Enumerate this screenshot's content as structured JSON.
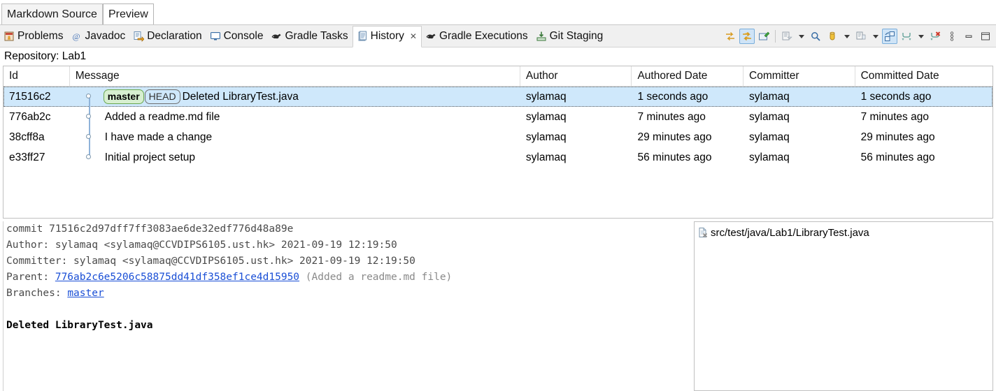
{
  "editor_tabs": [
    {
      "label": "Markdown Source",
      "active": false
    },
    {
      "label": "Preview",
      "active": true
    }
  ],
  "view_tabs": [
    {
      "label": "Problems",
      "icon": "problems-icon",
      "active": false,
      "closable": false
    },
    {
      "label": "Javadoc",
      "icon": "javadoc-icon",
      "active": false,
      "closable": false
    },
    {
      "label": "Declaration",
      "icon": "declaration-icon",
      "active": false,
      "closable": false
    },
    {
      "label": "Console",
      "icon": "console-icon",
      "active": false,
      "closable": false
    },
    {
      "label": "Gradle Tasks",
      "icon": "gradle-icon",
      "active": false,
      "closable": false
    },
    {
      "label": "History",
      "icon": "history-icon",
      "active": true,
      "closable": true,
      "close_glyph": "✕"
    },
    {
      "label": "Gradle Executions",
      "icon": "gradle-icon",
      "active": false,
      "closable": false
    },
    {
      "label": "Git Staging",
      "icon": "git-staging-icon",
      "active": false,
      "closable": false
    }
  ],
  "toolbar": {
    "buttons": [
      {
        "name": "compare-mode-button",
        "icon": "two-arrows-yellow-icon",
        "selected": false
      },
      {
        "name": "show-all-branches-button",
        "icon": "two-arrows-yellow-selected-icon",
        "selected": true
      },
      {
        "name": "open-git-repository-button",
        "icon": "open-editor-icon",
        "selected": false
      },
      {
        "name": "separator-1",
        "icon": "separator",
        "selected": false
      },
      {
        "name": "find-toggle-button",
        "icon": "filter-list-icon",
        "selected": false
      },
      {
        "name": "find-dropdown-arrow",
        "icon": "chevron-down-icon",
        "selected": false
      },
      {
        "name": "search-button",
        "icon": "search-icon",
        "selected": false
      },
      {
        "name": "filter-resource-button",
        "icon": "column-yellow-icon",
        "selected": false
      },
      {
        "name": "filter-dropdown-arrow",
        "icon": "chevron-down-icon",
        "selected": false
      },
      {
        "name": "separator-2",
        "icon": "separator",
        "selected": false
      },
      {
        "name": "compare-with-each-other-button",
        "icon": "compare-icon",
        "selected": false
      },
      {
        "name": "configure-columns-dropdown",
        "icon": "chevron-down-icon",
        "selected": false
      },
      {
        "name": "toggle-comment-button",
        "icon": "layout-blue-icon",
        "selected": true
      },
      {
        "name": "merge-button",
        "icon": "merge-arrows-icon",
        "selected": false
      },
      {
        "name": "merge-dropdown-arrow",
        "icon": "chevron-down-icon",
        "selected": false
      },
      {
        "name": "delete-branch-button",
        "icon": "merge-delete-icon",
        "selected": false
      },
      {
        "name": "view-menu-button",
        "icon": "view-menu-icon",
        "selected": false
      },
      {
        "name": "minimize-button",
        "icon": "minimize-icon",
        "selected": false
      },
      {
        "name": "maximize-button",
        "icon": "maximize-icon",
        "selected": false
      }
    ]
  },
  "repository": {
    "label": "Repository: Lab1"
  },
  "table": {
    "columns": [
      {
        "key": "id",
        "label": "Id"
      },
      {
        "key": "msg",
        "label": "Message"
      },
      {
        "key": "auth",
        "label": "Author"
      },
      {
        "key": "adate",
        "label": "Authored Date"
      },
      {
        "key": "comm",
        "label": "Committer"
      },
      {
        "key": "cdate",
        "label": "Committed Date"
      }
    ],
    "rows": [
      {
        "id": "71516c2",
        "refs": [
          {
            "name": "master",
            "type": "branch"
          },
          {
            "name": "HEAD",
            "type": "head"
          }
        ],
        "message": "Deleted LibraryTest.java",
        "author": "sylamaq",
        "authored_date": "1 seconds ago",
        "committer": "sylamaq",
        "committed_date": "1 seconds ago",
        "selected": true,
        "graph": "start"
      },
      {
        "id": "776ab2c",
        "refs": [],
        "message": "Added a readme.md file",
        "author": "sylamaq",
        "authored_date": "7 minutes ago",
        "committer": "sylamaq",
        "committed_date": "7 minutes ago",
        "selected": false,
        "graph": "middle"
      },
      {
        "id": "38cff8a",
        "refs": [],
        "message": "I have made a change",
        "author": "sylamaq",
        "authored_date": "29 minutes ago",
        "committer": "sylamaq",
        "committed_date": "29 minutes ago",
        "selected": false,
        "graph": "middle"
      },
      {
        "id": "e33ff27",
        "refs": [],
        "message": "Initial project setup",
        "author": "sylamaq",
        "authored_date": "56 minutes ago",
        "committer": "sylamaq",
        "committed_date": "56 minutes ago",
        "selected": false,
        "graph": "end"
      }
    ]
  },
  "detail": {
    "commit_line": "commit 71516c2d97dff7ff3083ae6de32edf776d48a89e",
    "author_line": "Author: sylamaq <sylamaq@CCVDIPS6105.ust.hk> 2021-09-19 12:19:50",
    "committer_line": "Committer: sylamaq <sylamaq@CCVDIPS6105.ust.hk> 2021-09-19 12:19:50",
    "parent_label": "Parent: ",
    "parent_hash": "776ab2c6e5206c58875dd41df358ef1ce4d15950",
    "parent_note": " (Added a readme.md file)",
    "branches_label": "Branches: ",
    "branches_value": "master",
    "message_body": "Deleted LibraryTest.java"
  },
  "file_list": {
    "items": [
      {
        "path": "src/test/java/Lab1/LibraryTest.java",
        "icon": "java-file-removed-icon"
      }
    ]
  },
  "colors": {
    "selection_blue": "#cfe8fb",
    "branch_green_bg": "#d7efd0",
    "branch_green_border": "#6aa84f",
    "link_blue": "#1a4fd6",
    "graph_line": "#8fb3d9",
    "toolbar_selected": "#cfe4f7"
  }
}
